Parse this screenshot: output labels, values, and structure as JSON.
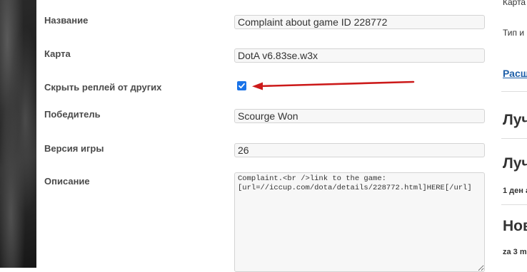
{
  "form": {
    "name_label": "Название",
    "name_value": "Complaint about game ID 228772",
    "map_label": "Карта",
    "map_value": "DotA v6.83se.w3x",
    "hide_label": "Скрыть реплей от других",
    "hide_checked": true,
    "winner_label": "Победитель",
    "winner_value": "Scourge Won",
    "version_label": "Версия игры",
    "version_value": "26",
    "description_label": "Описание",
    "description_value": "Complaint.<br />link to the game:\n[url=//iccup.com/dota/details/228772.html]HERE[/url]"
  },
  "sidebar": {
    "map_label": "Карта",
    "type_label": "Тип и",
    "link_label": "Расш",
    "heading1": "Луч",
    "heading2": "Луч",
    "sub1": "1 ден а",
    "heading3": "Нов",
    "sub2": "za 3 m"
  },
  "colors": {
    "checkbox_accent": "#1a73e8",
    "annotation_arrow": "#cc1a1a",
    "link": "#1e5fa8"
  }
}
